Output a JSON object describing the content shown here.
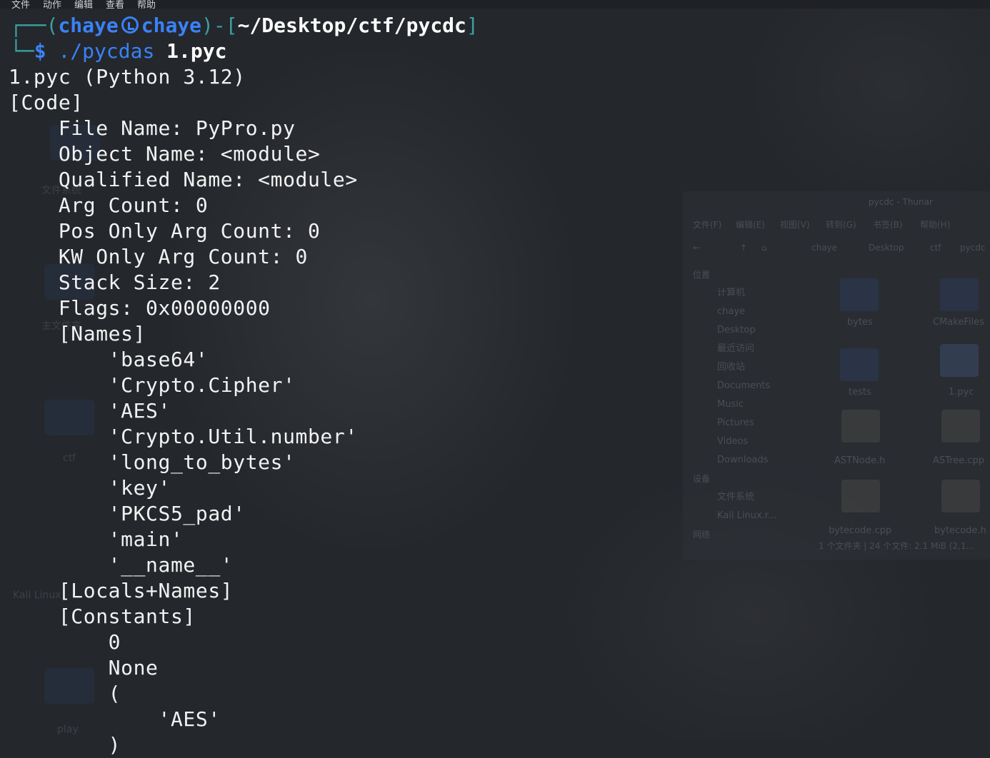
{
  "menubar": {
    "items": [
      "文件",
      "动作",
      "编辑",
      "查看",
      "帮助"
    ]
  },
  "desktop": {
    "labels": [
      "文件系统",
      "主文件夹",
      "ctf",
      "Kali Linux",
      "play"
    ]
  },
  "file_manager": {
    "title": "pycdc - Thunar",
    "menu": [
      "文件(F)",
      "编辑(E)",
      "视图(V)",
      "转到(G)",
      "书签(B)",
      "帮助(H)"
    ],
    "location": [
      "chaye",
      "Desktop",
      "ctf",
      "pycdc"
    ],
    "sidebar_place_header": "位置",
    "sidebar_places": [
      "计算机",
      "chaye",
      "Desktop",
      "最近访问",
      "回收站",
      "Documents",
      "Music",
      "Pictures",
      "Videos",
      "Downloads"
    ],
    "sidebar_device_header": "设备",
    "sidebar_devices": [
      "文件系统",
      "Kali Linux.r..."
    ],
    "sidebar_network_header": "网络",
    "files": [
      "bytes",
      "CMakeFiles",
      "tests",
      "1.pyc",
      "ASTNode.h",
      "ASTree.cpp",
      "bytecode.cpp",
      "bytecode.h"
    ],
    "status": "1 个文件夹 | 24 个文件: 2.1 MiB (2,1..."
  },
  "terminal": {
    "prompt": {
      "open": "┌──(",
      "user": "chaye",
      "host": "chaye",
      "mid": ")-[",
      "path": "~/Desktop/ctf/pycdc",
      "close": "]",
      "corner": "└─",
      "dollar": "$",
      "command": "./pycdas",
      "argument": "1.pyc"
    },
    "lines": [
      "1.pyc (Python 3.12)",
      "[Code]",
      "    File Name: PyPro.py",
      "    Object Name: <module>",
      "    Qualified Name: <module>",
      "    Arg Count: 0",
      "    Pos Only Arg Count: 0",
      "    KW Only Arg Count: 0",
      "    Stack Size: 2",
      "    Flags: 0x00000000",
      "    [Names]",
      "        'base64'",
      "        'Crypto.Cipher'",
      "        'AES'",
      "        'Crypto.Util.number'",
      "        'long_to_bytes'",
      "        'key'",
      "        'PKCS5_pad'",
      "        'main'",
      "        '__name__'",
      "    [Locals+Names]",
      "    [Constants]",
      "        0",
      "        None",
      "        (",
      "            'AES'",
      "        )"
    ]
  }
}
